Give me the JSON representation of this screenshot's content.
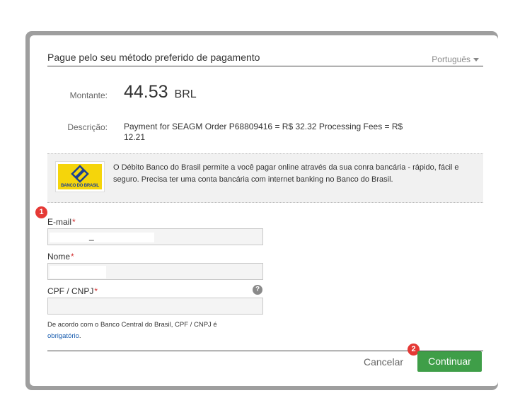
{
  "header": {
    "title": "Pague pelo seu método preferido de pagamento",
    "language": "Português"
  },
  "payment": {
    "amount_label": "Montante:",
    "amount": "44.53",
    "currency": "BRL",
    "description_label": "Descrição:",
    "description": "Payment for SEAGM Order P68809416 = R$ 32.32 Processing Fees = R$ 12.21"
  },
  "info": {
    "logo_text": "BANCO DO BRASIL",
    "text": "O Débito Banco do Brasil permite a você pagar online através da sua conra bancária - rápido, fácil e seguro. Precisa ter uma conta bancária com internet banking no Banco do Brasil."
  },
  "form": {
    "email_label": "E-mail",
    "name_label": "Nome",
    "cpf_label": "CPF / CNPJ",
    "required_mark": "*",
    "email_value": "_",
    "note_text": "De acordo com o Banco Central do Brasil, CPF / CNPJ é",
    "note_link": "obrigatório",
    "note_end": "."
  },
  "actions": {
    "cancel": "Cancelar",
    "continue": "Continuar"
  },
  "markers": {
    "one": "1",
    "two": "2"
  },
  "icons": {
    "help": "help-icon",
    "dropdown": "chevron-down-icon"
  },
  "colors": {
    "continue": "#3f9e48",
    "badge": "#e53935",
    "required": "#d32f2f"
  }
}
